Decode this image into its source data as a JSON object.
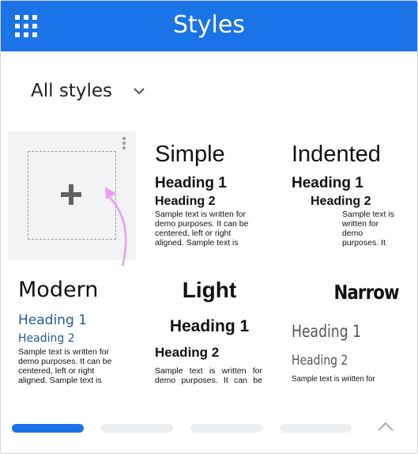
{
  "header": {
    "title": "Styles",
    "apps_icon": "apps-grid-icon"
  },
  "filter": {
    "label": "All styles",
    "icon": "chevron-down-icon"
  },
  "new_style": {
    "icon": "plus-icon",
    "menu_icon": "more-vert-icon"
  },
  "styles": [
    {
      "id": "simple",
      "name": "Simple",
      "heading1": "Heading 1",
      "heading2": "Heading 2",
      "sample": "Sample text is written for demo purposes. It can be centered, left or right aligned. Sample text is"
    },
    {
      "id": "indented",
      "name": "Indented",
      "heading1": "Heading 1",
      "heading2": "Heading 2",
      "sample": "Sample text is written for demo purposes. It"
    },
    {
      "id": "modern",
      "name": "Modern",
      "heading1": "Heading 1",
      "heading2": "Heading 2",
      "sample": "Sample text is written for demo purposes. It can be centered, left or right aligned. Sample text is"
    },
    {
      "id": "light",
      "name": "Light",
      "heading1": "Heading 1",
      "heading2": "Heading 2",
      "sample": "Sample text is written for demo purposes. It can be"
    },
    {
      "id": "narrow",
      "name": "Narrow",
      "heading1": "Heading 1",
      "heading2": "Heading 2",
      "sample": "Sample text is written for"
    }
  ],
  "pager": {
    "pages": 4,
    "active_index": 0,
    "scroll_icon": "chevron-up-icon"
  },
  "colors": {
    "accent": "#1b73e8",
    "modern_heading": "#1f5b94",
    "narrow_heading": "#555555",
    "pointer_arrow": "#ee9af5"
  }
}
